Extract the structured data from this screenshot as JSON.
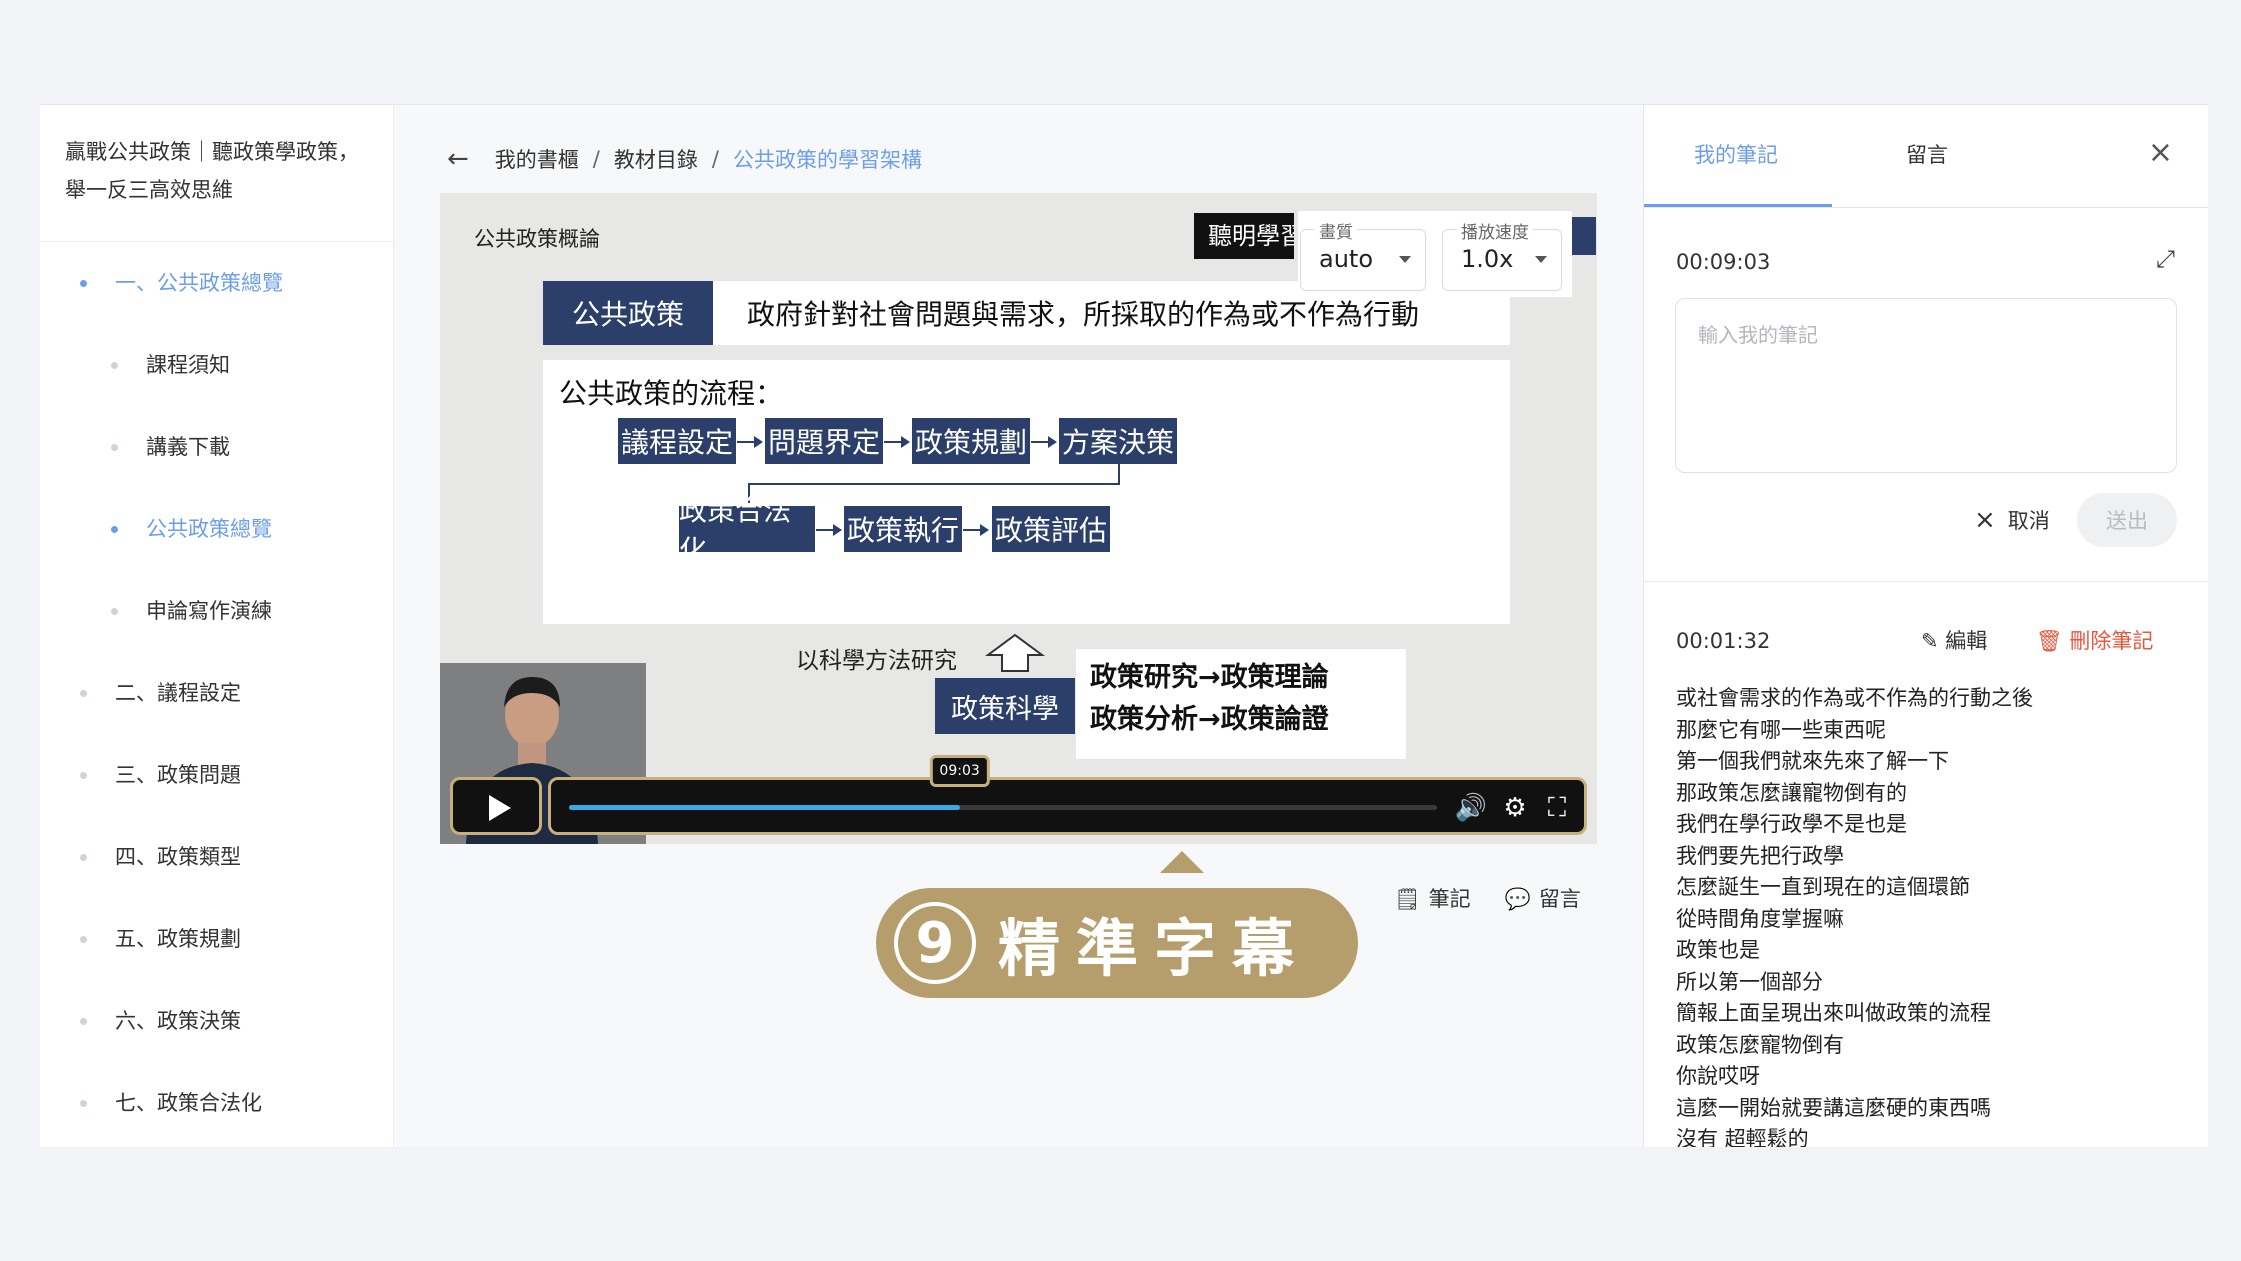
{
  "sidebar": {
    "course_title": "贏戰公共政策｜聽政策學政策，舉一反三高效思維",
    "items": [
      {
        "label": "一、公共政策總覽",
        "level": 1,
        "active": true
      },
      {
        "label": "課程須知",
        "level": 2,
        "active": false
      },
      {
        "label": "講義下載",
        "level": 2,
        "active": false
      },
      {
        "label": "公共政策總覽",
        "level": 2,
        "active": true
      },
      {
        "label": "申論寫作演練",
        "level": 2,
        "active": false
      },
      {
        "label": "二、議程設定",
        "level": 1,
        "active": false
      },
      {
        "label": "三、政策問題",
        "level": 1,
        "active": false
      },
      {
        "label": "四、政策類型",
        "level": 1,
        "active": false
      },
      {
        "label": "五、政策規劃",
        "level": 1,
        "active": false
      },
      {
        "label": "六、政策決策",
        "level": 1,
        "active": false
      },
      {
        "label": "七、政策合法化",
        "level": 1,
        "active": false
      }
    ]
  },
  "breadcrumb": {
    "items": [
      "我的書櫃",
      "教材目錄",
      "公共政策的學習架構"
    ],
    "separator": "/"
  },
  "video": {
    "slide": {
      "topic": "公共政策概論",
      "tag": "聽明學習",
      "definition_term": "公共政策",
      "definition_text": "政府針對社會問題與需求，所採取的作為或不作為行動",
      "flow_title": "公共政策的流程：",
      "flow_steps_row1": [
        "議程設定",
        "問題界定",
        "政策規劃",
        "方案決策"
      ],
      "flow_steps_row2": [
        "政策合法化",
        "政策執行",
        "政策評估"
      ],
      "science_label": "以科學方法研究",
      "science_box": "政策科學",
      "science_lines": [
        "政策研究→政策理論",
        "政策分析→政策論證"
      ]
    },
    "quality": {
      "caption": "畫質",
      "value": "auto"
    },
    "speed": {
      "caption": "播放速度",
      "value": "1.0x"
    },
    "progress_fraction": 0.45,
    "tooltip_time": "09:03"
  },
  "callout": {
    "number": "9",
    "label": "精準字幕"
  },
  "under_video": {
    "note_label": "筆記",
    "comment_label": "留言"
  },
  "panel": {
    "tab_notes": "我的筆記",
    "tab_comments": "留言",
    "current_time": "00:09:03",
    "input_placeholder": "輸入我的筆記",
    "cancel_label": "取消",
    "send_label": "送出",
    "saved_note": {
      "time": "00:01:32",
      "edit_label": "編輯",
      "delete_label": "刪除筆記",
      "lines": [
        "或社會需求的作為或不作為的行動之後",
        "那麼它有哪一些東西呢",
        "第一個我們就來先來了解一下",
        "那政策怎麼讓寵物倒有的",
        "我們在學行政學不是也是",
        "我們要先把行政學",
        "怎麼誕生一直到現在的這個環節",
        "從時間角度掌握嘛",
        "政策也是",
        "所以第一個部分",
        "簡報上面呈現出來叫做政策的流程",
        "政策怎麼寵物倒有",
        "你說哎呀",
        "這麼一開始就要講這麼硬的東西嗎",
        "沒有 超輕鬆的"
      ]
    }
  },
  "colors": {
    "accent": "#6d9eea",
    "slide_navy": "#2b3f6a",
    "callout_gold": "#b59e6c",
    "delete_red": "#e8563f",
    "progress_blue": "#3aa7e6"
  }
}
